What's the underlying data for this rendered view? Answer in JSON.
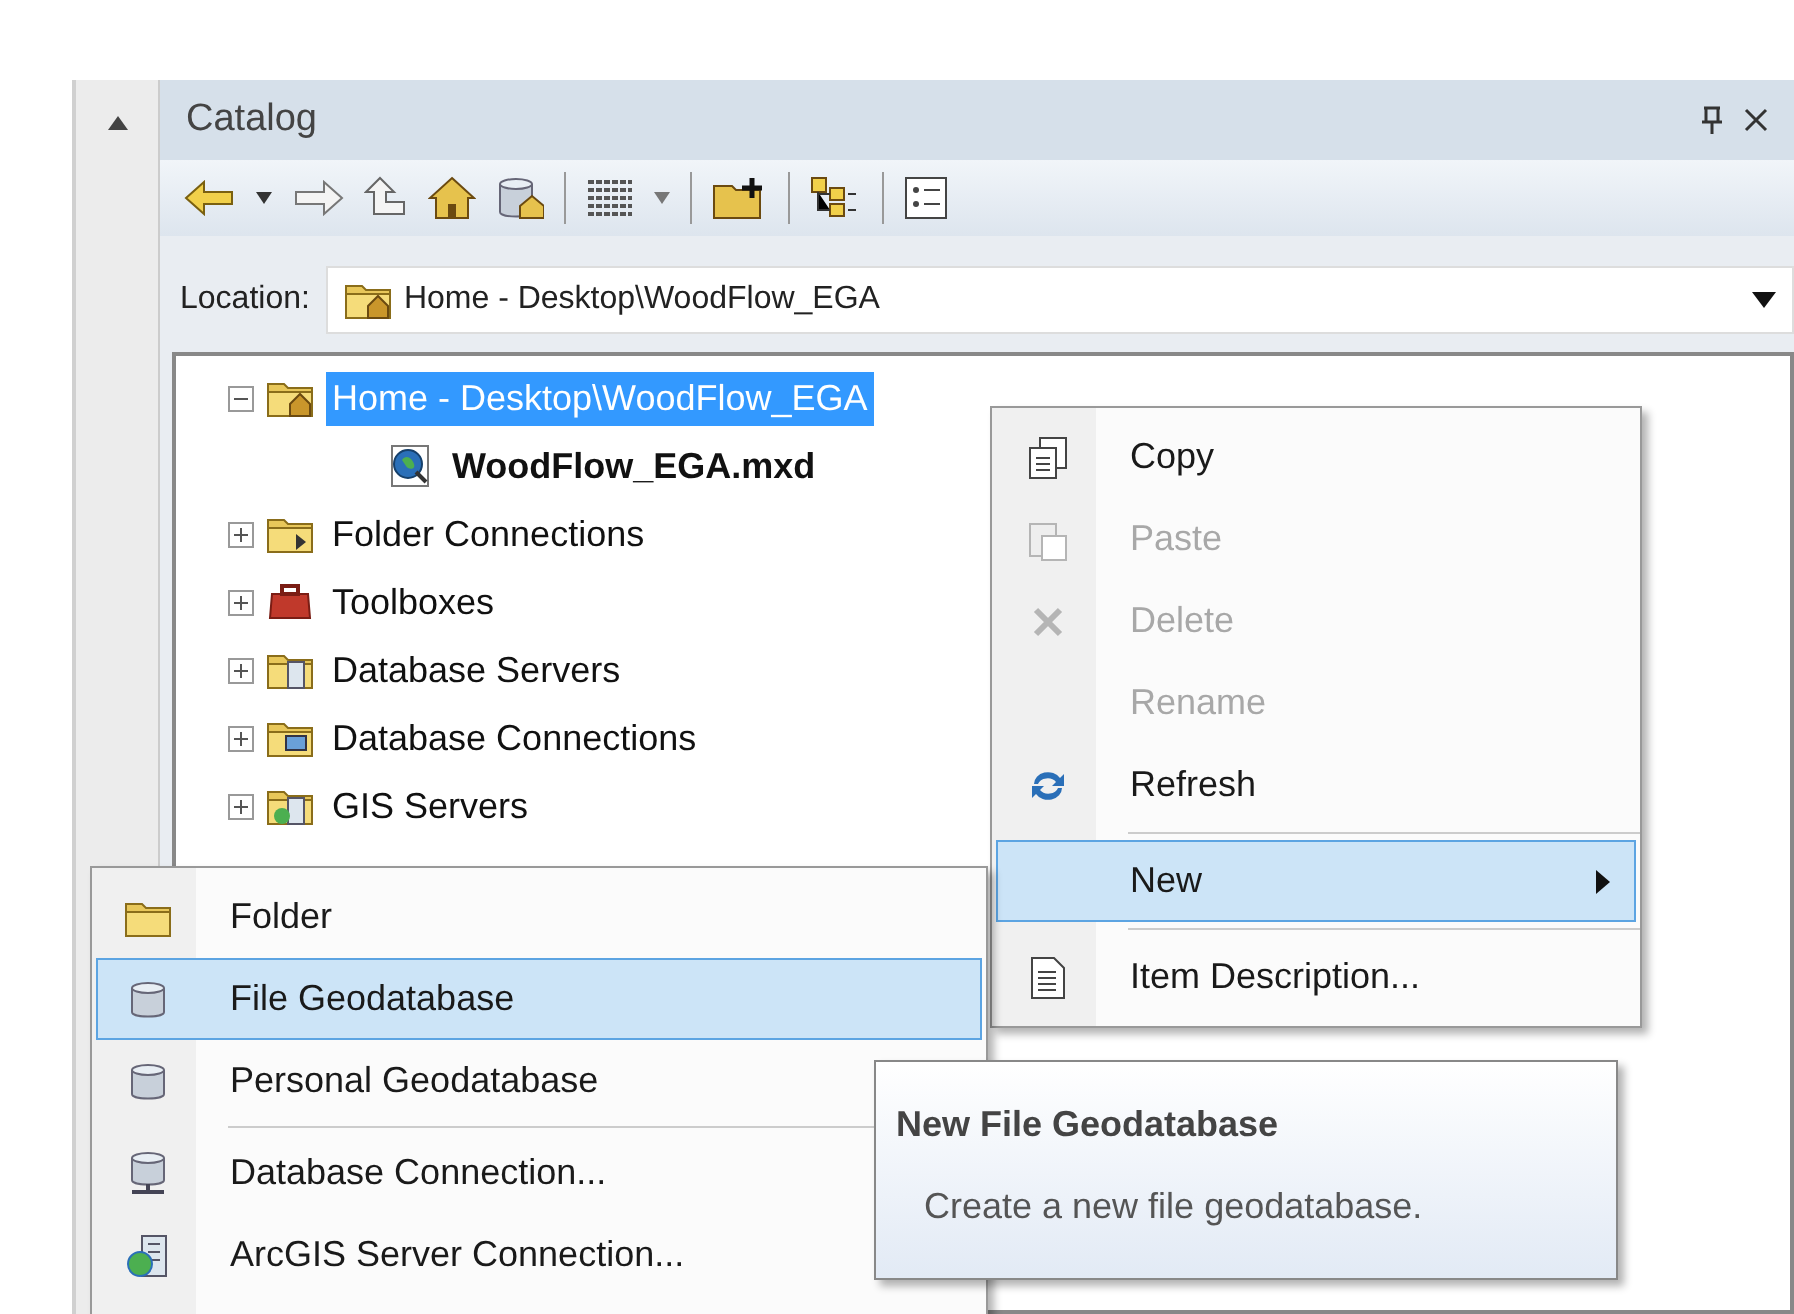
{
  "panel": {
    "title": "Catalog"
  },
  "location": {
    "label": "Location:",
    "value": "Home - Desktop\\WoodFlow_EGA"
  },
  "tree": [
    {
      "label": "Home - Desktop\\WoodFlow_EGA",
      "kind": "home",
      "expanded": true,
      "selected": true,
      "children": [
        {
          "label": "WoodFlow_EGA.mxd",
          "kind": "map",
          "selected": false
        }
      ]
    },
    {
      "label": "Folder Connections",
      "kind": "folderlink",
      "expanded": false,
      "selected": false
    },
    {
      "label": "Toolboxes",
      "kind": "toolbox",
      "expanded": false,
      "selected": false
    },
    {
      "label": "Database Servers",
      "kind": "server",
      "expanded": false,
      "selected": false
    },
    {
      "label": "Database Connections",
      "kind": "dbconn",
      "expanded": false,
      "selected": false
    },
    {
      "label": "GIS Servers",
      "kind": "gis",
      "expanded": false,
      "selected": false
    }
  ],
  "context_menu": [
    {
      "label": "Copy",
      "kind": "copy",
      "disabled": false,
      "selected": false
    },
    {
      "label": "Paste",
      "kind": "paste",
      "disabled": true,
      "selected": false
    },
    {
      "label": "Delete",
      "kind": "delete",
      "disabled": true,
      "selected": false
    },
    {
      "label": "Rename",
      "kind": "none",
      "disabled": true,
      "selected": false
    },
    {
      "label": "Refresh",
      "kind": "refresh",
      "disabled": false,
      "selected": false
    },
    {
      "label": "New",
      "kind": "submenu",
      "disabled": false,
      "selected": true
    },
    {
      "label": "Item Description...",
      "kind": "description",
      "disabled": false,
      "selected": false
    }
  ],
  "submenu": [
    {
      "label": "Folder",
      "kind": "folder",
      "selected": false
    },
    {
      "label": "File Geodatabase",
      "kind": "database",
      "selected": true
    },
    {
      "label": "Personal Geodatabase",
      "kind": "database",
      "selected": false
    },
    {
      "label": "Database Connection...",
      "kind": "dbconnection",
      "selected": false
    },
    {
      "label": "ArcGIS Server Connection...",
      "kind": "gis",
      "selected": false
    }
  ],
  "tooltip": {
    "title": "New File Geodatabase",
    "text": "Create a new file geodatabase."
  }
}
